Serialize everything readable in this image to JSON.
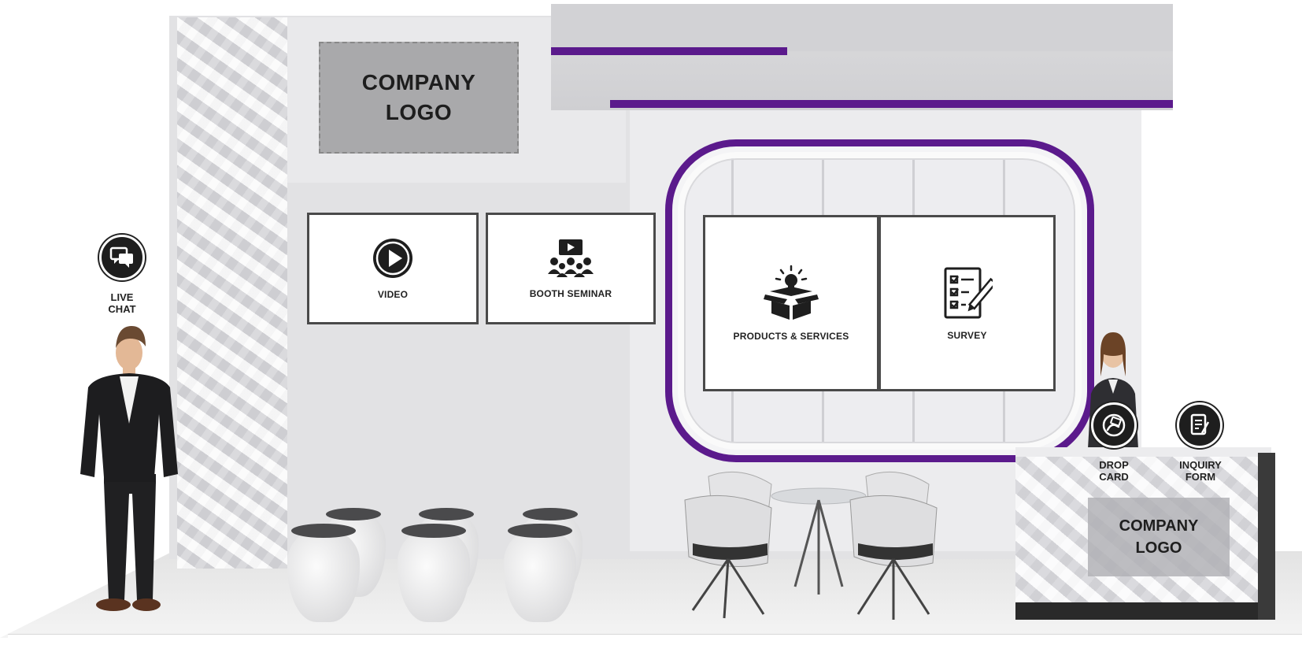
{
  "booth": {
    "company_logo_main": "COMPANY\nLOGO",
    "company_logo_desk": "COMPANY\nLOGO"
  },
  "screens": {
    "video": {
      "label": "VIDEO",
      "icon": "play-icon"
    },
    "booth_seminar": {
      "label": "BOOTH SEMINAR",
      "icon": "seminar-presentation-icon"
    },
    "products_services": {
      "label": "PRODUCTS & SERVICES",
      "icon": "idea-box-icon"
    },
    "survey": {
      "label": "SURVEY",
      "icon": "checklist-icon"
    }
  },
  "actions": {
    "live_chat": {
      "label": "LIVE\nCHAT",
      "icon": "chat-bubbles-icon"
    },
    "drop_card": {
      "label": "DROP\nCARD",
      "icon": "hand-card-icon"
    },
    "inquiry_form": {
      "label": "INQUIRY\nFORM",
      "icon": "form-icon"
    }
  },
  "colors": {
    "accent": "#5b1a8c",
    "icon_circle": "#1e1e1e",
    "logo_placeholder": "#a9a9ab"
  }
}
